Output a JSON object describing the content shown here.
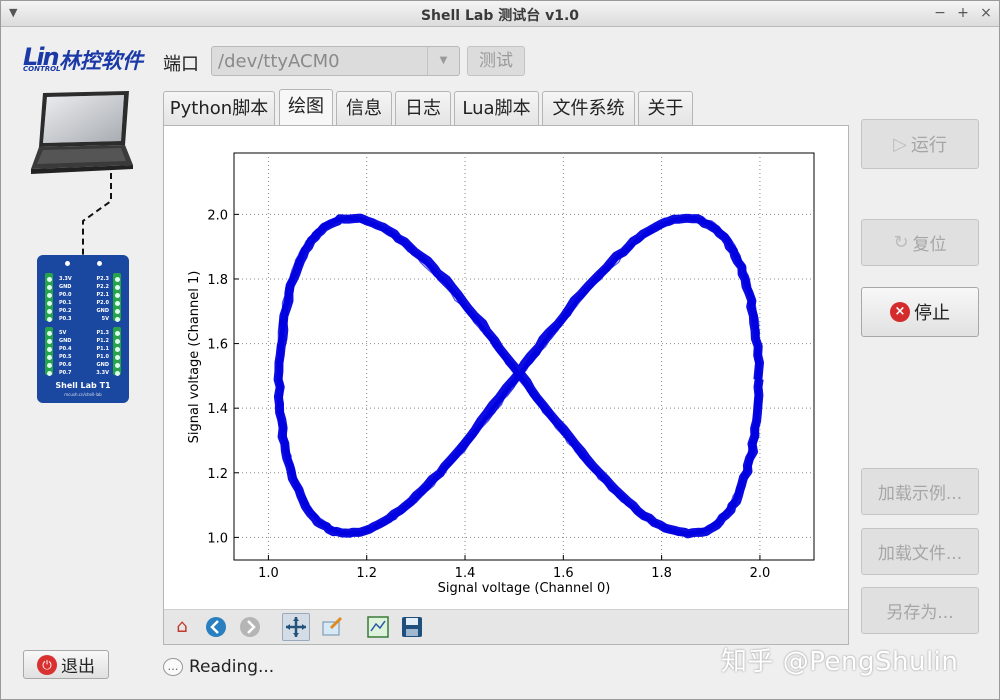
{
  "window": {
    "title": "Shell Lab 测试台 v1.0",
    "controls": [
      "−",
      "+",
      "×"
    ]
  },
  "logo": {
    "lin": "Lin",
    "control": "CONTROL",
    "cn": "林控软件"
  },
  "board": {
    "name": "Shell Lab T1",
    "url": "mcush.cn/shell-lab",
    "left_pins": [
      "3.3V",
      "GND",
      "P0.0",
      "P0.1",
      "P0.2",
      "P0.3",
      "5V",
      "GND",
      "P0.4",
      "P0.5",
      "P0.6",
      "P0.7"
    ],
    "right_pins": [
      "P2.3",
      "P2.2",
      "P2.1",
      "P2.0",
      "GND",
      "5V",
      "P1.3",
      "P1.2",
      "P1.1",
      "P1.0",
      "GND",
      "3.3V"
    ]
  },
  "port": {
    "label": "端口",
    "value": "/dev/ttyACM0",
    "test_label": "测试"
  },
  "tabs": [
    "Python脚本",
    "绘图",
    "信息",
    "日志",
    "Lua脚本",
    "文件系统",
    "关于"
  ],
  "active_tab": 1,
  "buttons": {
    "run": "运行",
    "reset": "复位",
    "stop": "停止",
    "load_example": "加载示例...",
    "load_file": "加载文件...",
    "save_as": "另存为...",
    "exit": "退出"
  },
  "status": {
    "text": "Reading..."
  },
  "watermark": "知乎 @PengShulin",
  "chart_data": {
    "type": "line",
    "title": "",
    "xlabel": "Signal voltage (Channel 0)",
    "ylabel": "Signal voltage (Channel 1)",
    "xlim": [
      0.93,
      2.11
    ],
    "ylim": [
      0.93,
      2.19
    ],
    "xticks": [
      1.0,
      1.2,
      1.4,
      1.6,
      1.8,
      2.0
    ],
    "yticks": [
      1.0,
      1.2,
      1.4,
      1.6,
      1.8,
      2.0
    ],
    "grid": true,
    "series": [
      {
        "name": "",
        "color": "#0000e0",
        "shape": "lissajous figure-eight",
        "x_center": 1.51,
        "x_amplitude": 0.49,
        "y_center": 1.5,
        "y_amplitude": 0.49,
        "frequency_ratio": "1:2"
      }
    ]
  }
}
